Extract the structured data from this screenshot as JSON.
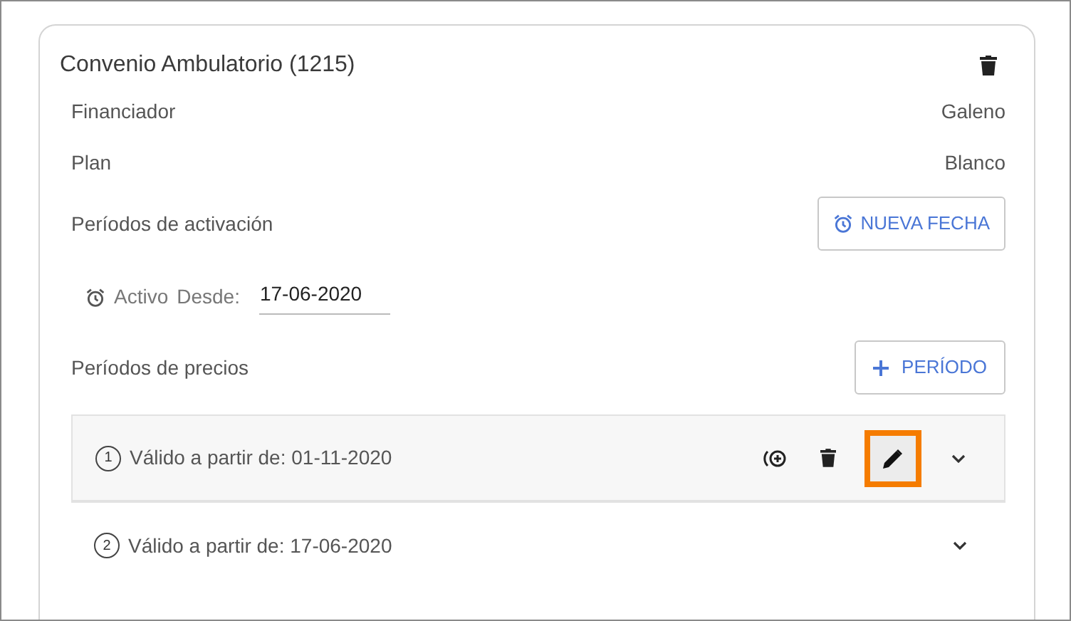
{
  "card": {
    "title": "Convenio Ambulatorio (1215)",
    "fields": [
      {
        "label": "Financiador",
        "value": "Galeno"
      },
      {
        "label": "Plan",
        "value": "Blanco"
      }
    ],
    "activation": {
      "label": "Períodos de activación",
      "button": "NUEVA FECHA",
      "status": "Activo",
      "since_label": "Desde:",
      "since_value": "17-06-2020"
    },
    "prices": {
      "label": "Períodos de precios",
      "button": "PERÍODO",
      "periods": [
        {
          "number": "1",
          "text": "Válido a partir de:",
          "date": "01-11-2020",
          "selected": true,
          "edit_highlighted": true
        },
        {
          "number": "2",
          "text": "Válido a partir de:",
          "date": "17-06-2020",
          "selected": false
        }
      ]
    }
  }
}
